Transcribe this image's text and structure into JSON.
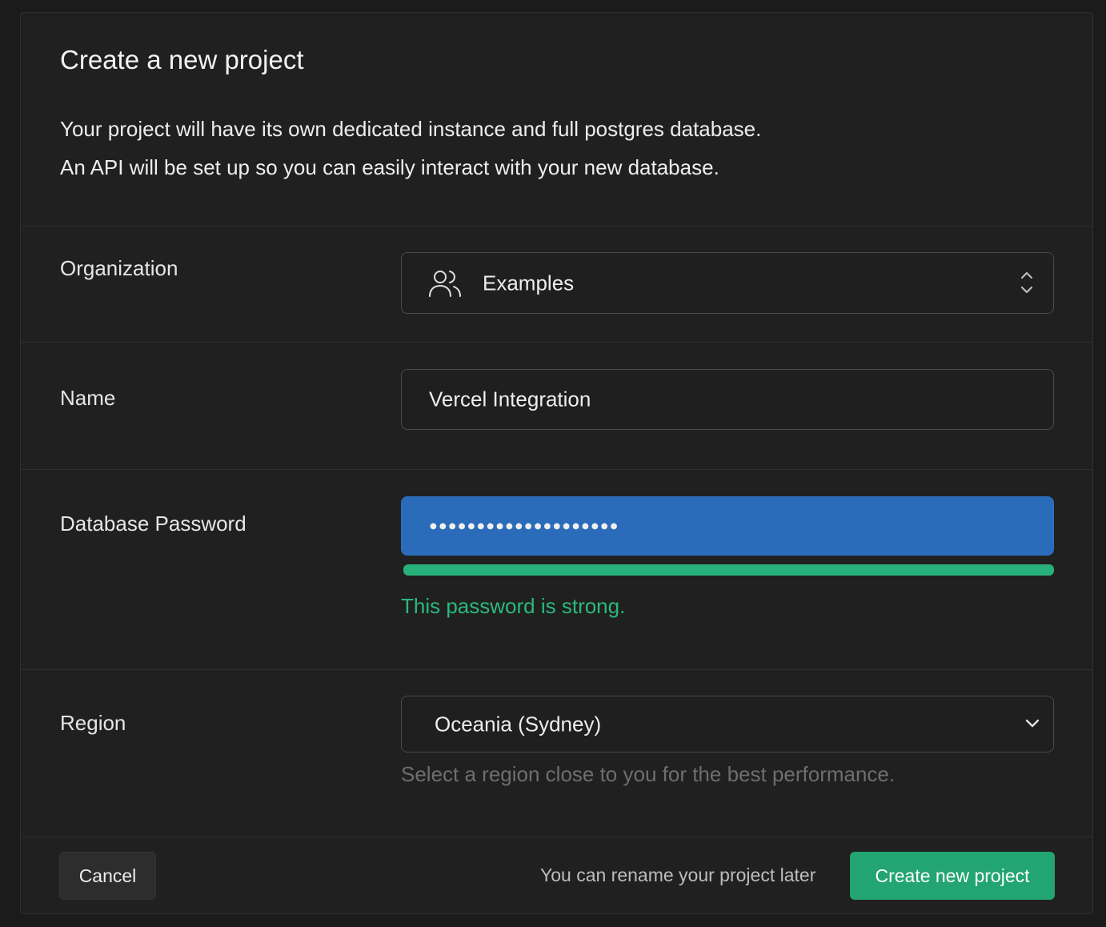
{
  "dialog": {
    "title": "Create a new project",
    "description_line1": "Your project will have its own dedicated instance and full postgres database.",
    "description_line2": "An API will be set up so you can easily interact with your new database."
  },
  "organization": {
    "label": "Organization",
    "value": "Examples",
    "icon": "users-icon",
    "control_icon": "up-down-chevron-icon"
  },
  "name": {
    "label": "Name",
    "value": "Vercel Integration"
  },
  "password": {
    "label": "Database Password",
    "masked_value": "●●●●●●●●●●●●●●●●●●●●",
    "strength_fraction": 1.0,
    "strength_message": "This password is strong."
  },
  "region": {
    "label": "Region",
    "selected": "Oceania (Sydney)",
    "hint": "Select a region close to you for the best performance.",
    "control_icon": "chevron-down-icon"
  },
  "footer": {
    "cancel_label": "Cancel",
    "rename_note": "You can rename your project later",
    "create_label": "Create new project"
  },
  "colors": {
    "background": "#1b1b1b",
    "panel": "#202020",
    "accent_green": "#23a572",
    "password_fill": "#2a6bba",
    "success_text": "#2bb87f"
  }
}
